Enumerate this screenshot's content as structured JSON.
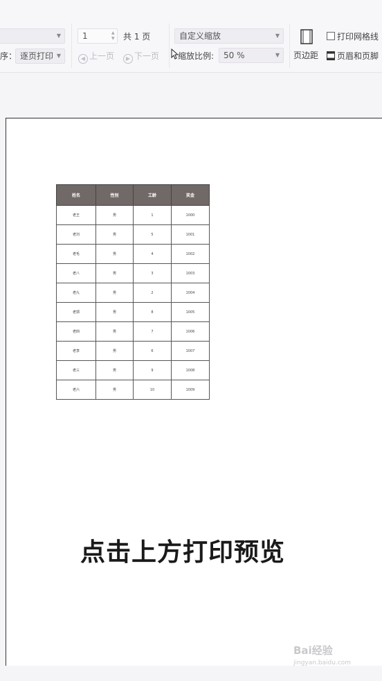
{
  "toolbar": {
    "order_label": "序：",
    "order_value": "逐页打印",
    "page_input": "1",
    "page_total": "共 1 页",
    "prev_page": "上一页",
    "next_page": "下一页",
    "zoom_mode": "自定义缩放",
    "zoom_label": "缩放比例:",
    "zoom_value": "50 %",
    "margins_label": "页边距",
    "print_gridlines_label": "打印网格线",
    "header_footer_label": "页眉和页脚"
  },
  "sheet": {
    "headers": [
      "姓名",
      "性别",
      "工龄",
      "奖金"
    ],
    "rows": [
      [
        "老王",
        "男",
        "1",
        "1000"
      ],
      [
        "老刘",
        "男",
        "5",
        "1001"
      ],
      [
        "老毛",
        "男",
        "4",
        "1002"
      ],
      [
        "老八",
        "男",
        "3",
        "1003"
      ],
      [
        "老九",
        "男",
        "2",
        "1004"
      ],
      [
        "老郭",
        "男",
        "8",
        "1005"
      ],
      [
        "老四",
        "男",
        "7",
        "1006"
      ],
      [
        "老李",
        "男",
        "6",
        "1007"
      ],
      [
        "老三",
        "男",
        "9",
        "1008"
      ],
      [
        "老六",
        "男",
        "10",
        "1009"
      ]
    ]
  },
  "caption": "点击上方打印预览",
  "watermark": {
    "brand": "Bai经验",
    "url": "jingyan.baidu.com"
  }
}
